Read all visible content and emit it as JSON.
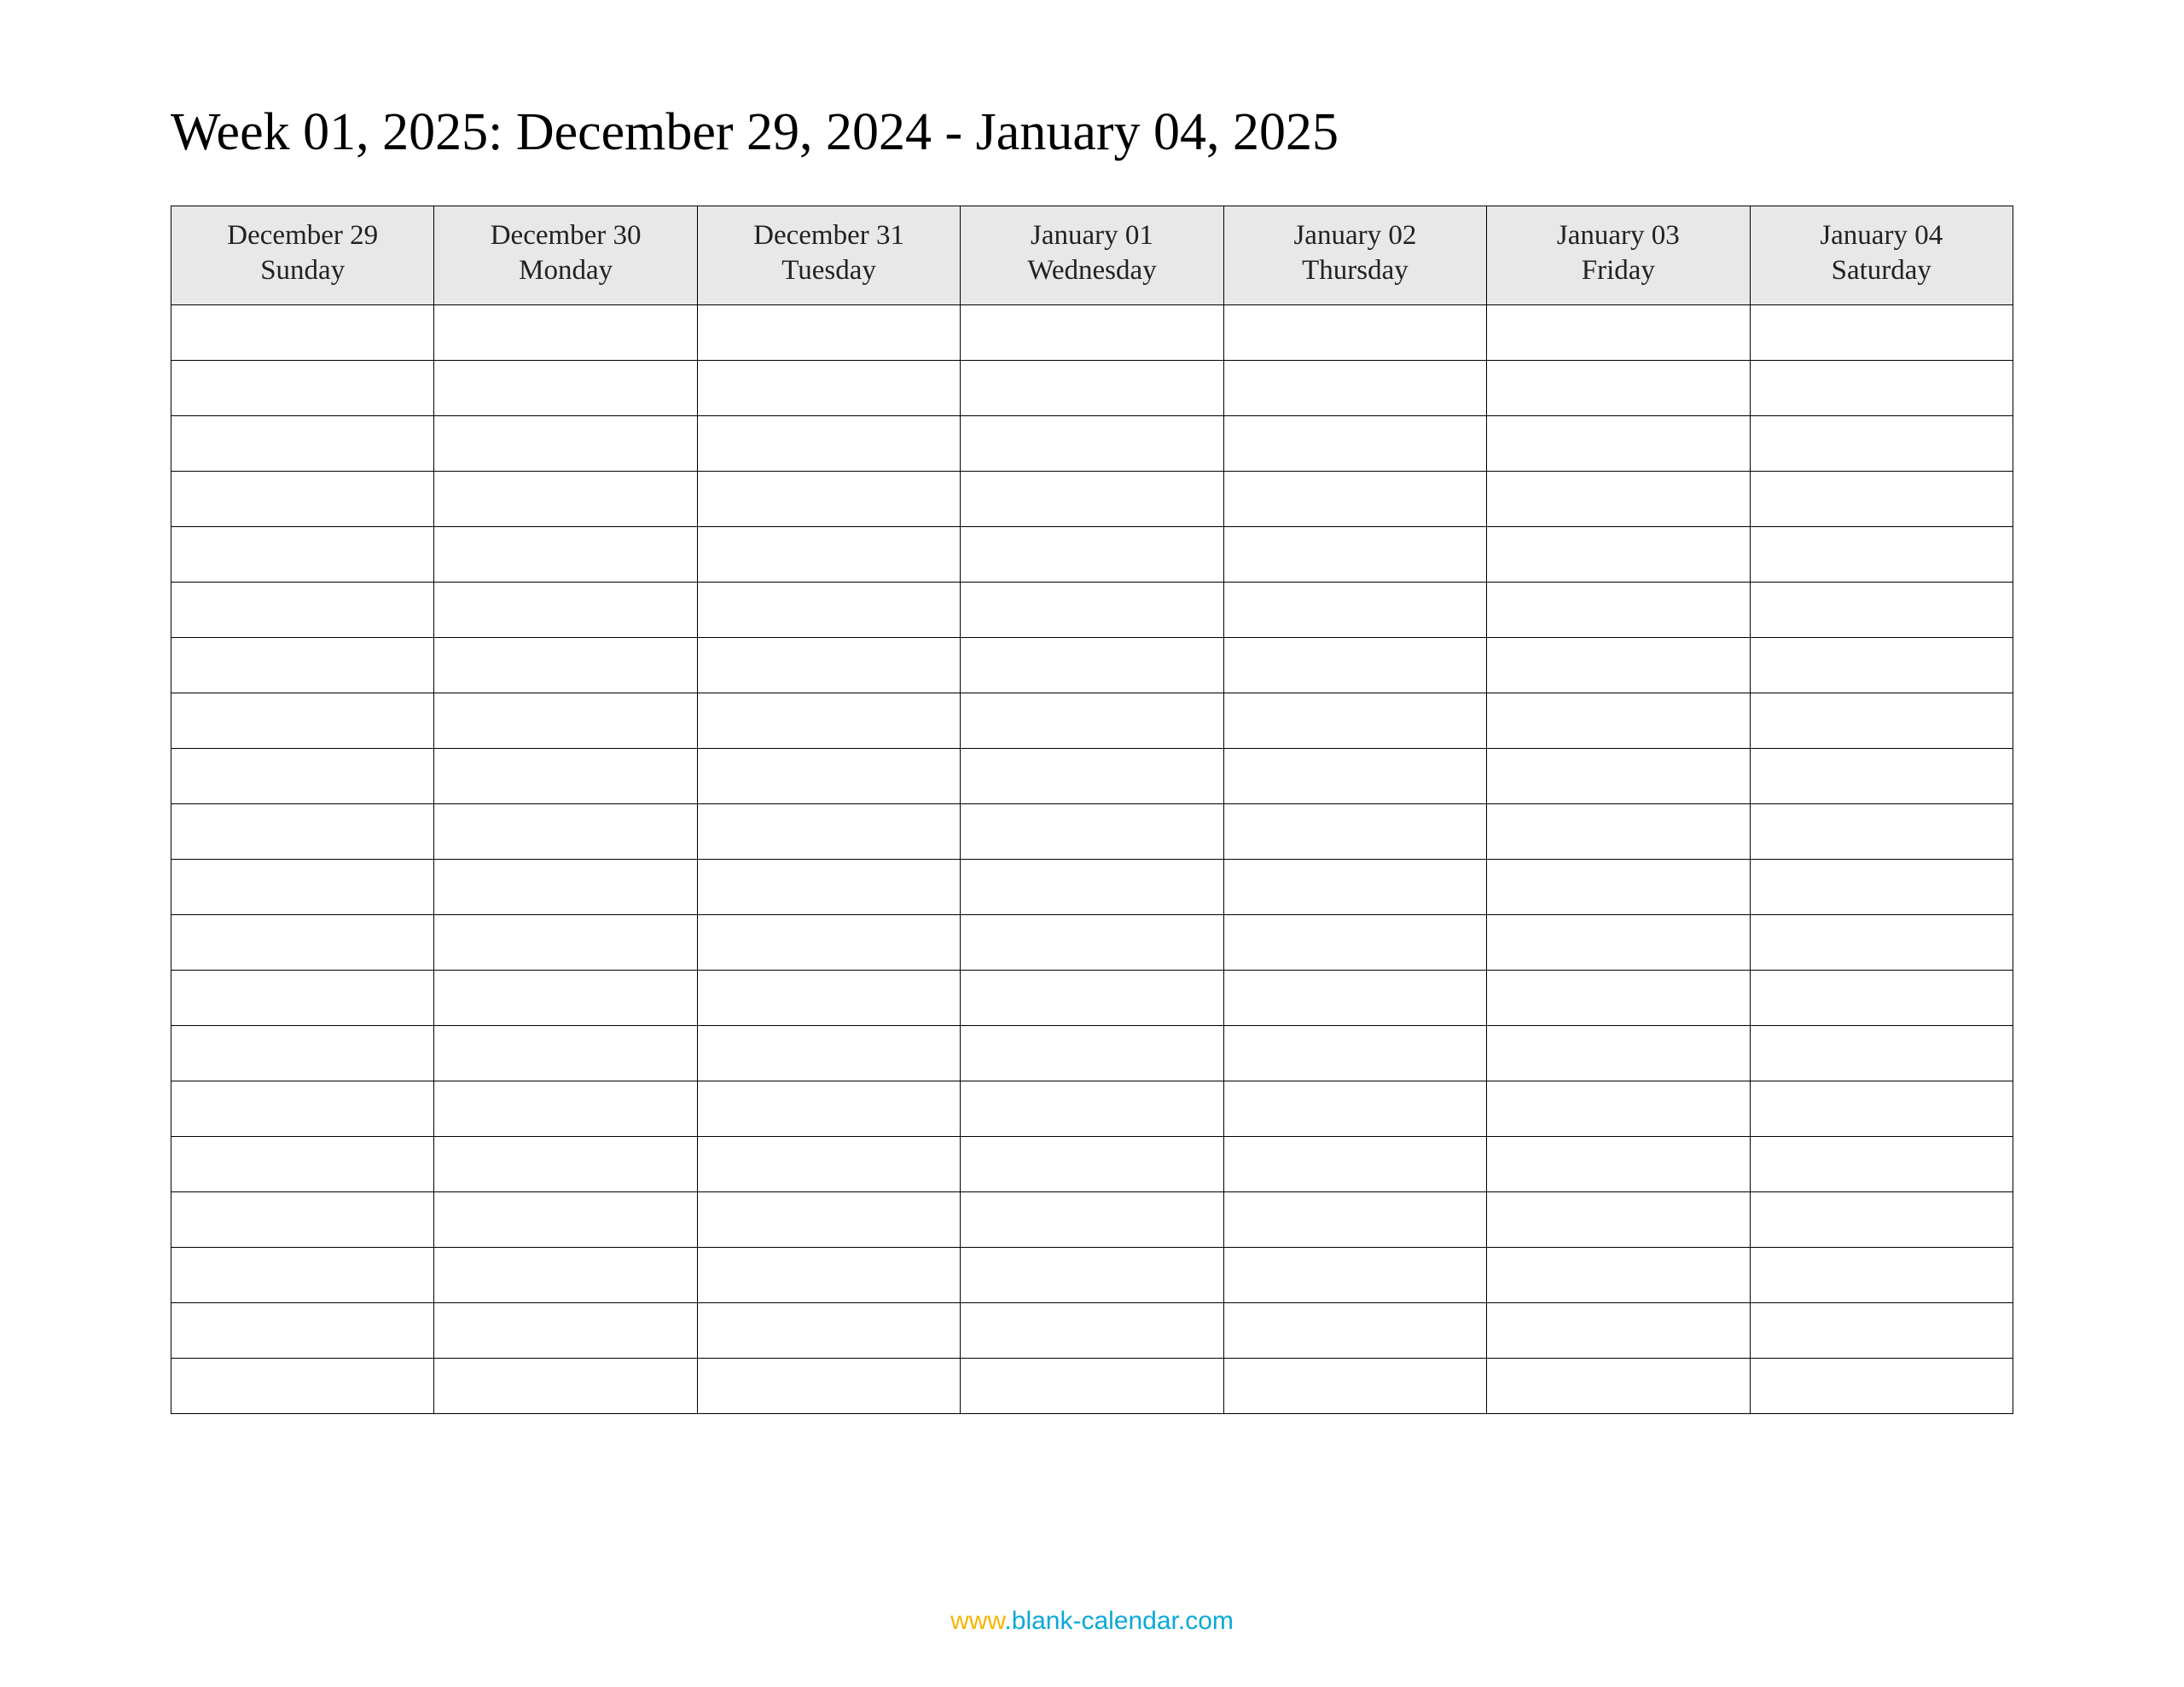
{
  "title": "Week 01, 2025: December 29, 2024 - January 04, 2025",
  "columns": [
    {
      "date": "December 29",
      "day": "Sunday"
    },
    {
      "date": "December 30",
      "day": "Monday"
    },
    {
      "date": "December 31",
      "day": "Tuesday"
    },
    {
      "date": "January 01",
      "day": "Wednesday"
    },
    {
      "date": "January 02",
      "day": "Thursday"
    },
    {
      "date": "January 03",
      "day": "Friday"
    },
    {
      "date": "January 04",
      "day": "Saturday"
    }
  ],
  "blank_rows": 20,
  "footer": {
    "www": "www",
    "link": ".blank-calendar.com"
  }
}
